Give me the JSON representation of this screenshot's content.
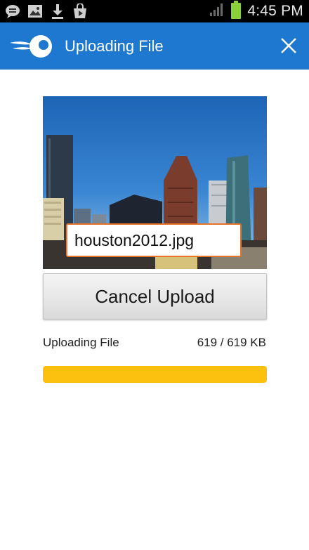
{
  "status_bar": {
    "time": "4:45 PM",
    "icons": [
      "chat-icon",
      "gallery-icon",
      "download-icon",
      "shop-icon",
      "signal-icon",
      "battery-icon"
    ]
  },
  "action_bar": {
    "title": "Uploading File",
    "close_icon": "close-icon",
    "background_color": "#1f78cf"
  },
  "preview": {
    "filename": "houston2012.jpg",
    "filename_border_color": "#e8742a"
  },
  "cancel_button": {
    "label": "Cancel Upload"
  },
  "progress": {
    "label": "Uploading File",
    "size_text": "619 / 619 KB",
    "fraction": 1.0,
    "fill_color": "#fcc10f"
  }
}
